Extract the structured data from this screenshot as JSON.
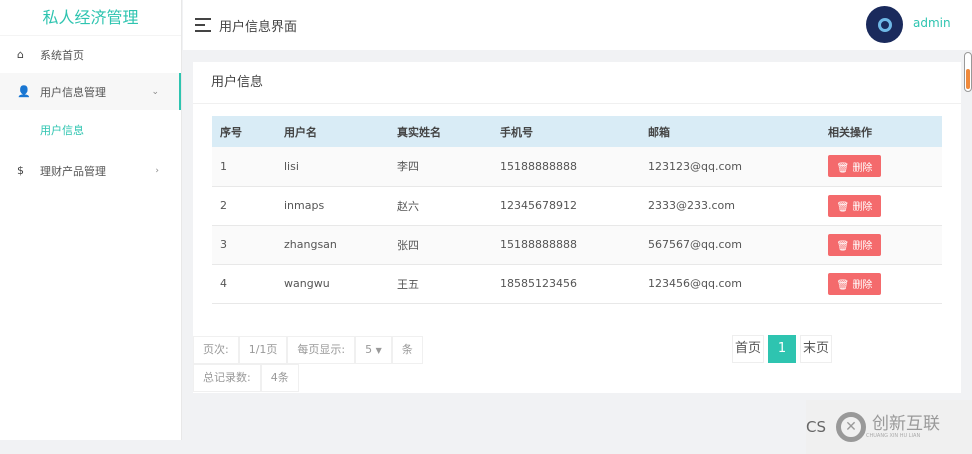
{
  "app_title": "私人经济管理",
  "sidebar": {
    "items": [
      {
        "label": "系统首页",
        "icon": "home-icon"
      },
      {
        "label": "用户信息管理",
        "icon": "user-gear-icon",
        "expanded": true,
        "children": [
          {
            "label": "用户信息"
          }
        ]
      },
      {
        "label": "理财产品管理",
        "icon": "money-icon"
      }
    ]
  },
  "header": {
    "title": "用户信息界面",
    "username": "admin"
  },
  "card": {
    "title": "用户信息"
  },
  "table": {
    "headers": [
      "序号",
      "用户名",
      "真实姓名",
      "手机号",
      "邮箱",
      "相关操作"
    ],
    "rows": [
      [
        "1",
        "lisi",
        "李四",
        "15188888888",
        "123123@qq.com"
      ],
      [
        "2",
        "inmaps",
        "赵六",
        "12345678912",
        "2333@233.com"
      ],
      [
        "3",
        "zhangsan",
        "张四",
        "15188888888",
        "567567@qq.com"
      ],
      [
        "4",
        "wangwu",
        "王五",
        "18585123456",
        "123456@qq.com"
      ]
    ],
    "delete_label": "删除"
  },
  "pagination": {
    "page_label": "页次:",
    "page_value": "1/1页",
    "per_page_label": "每页显示:",
    "per_page_value": "5",
    "per_page_unit": "条",
    "total_label": "总记录数:",
    "total_value": "4条",
    "first": "首页",
    "current": "1",
    "last": "末页"
  },
  "watermark": {
    "prefix": "CS",
    "brand": "创新互联",
    "brand_en": "CHUANG XIN HU LIAN"
  },
  "colors": {
    "accent": "#2ec4b0",
    "danger": "#f46a6c"
  }
}
